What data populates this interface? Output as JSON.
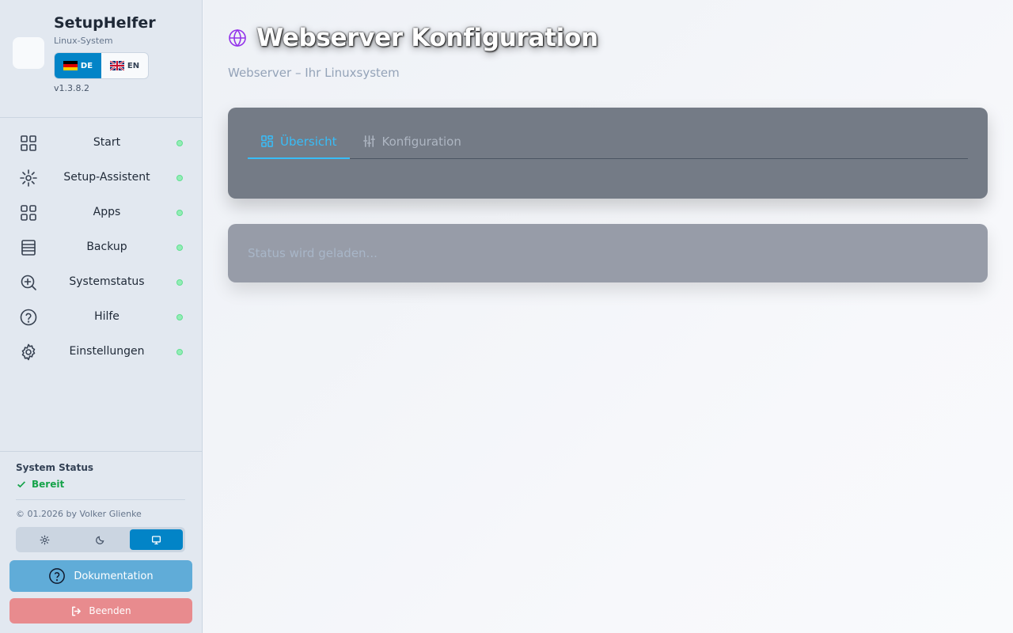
{
  "app": {
    "title": "SetupHelfer",
    "subtitle": "Linux-System",
    "version": "v1.3.8.2",
    "languages": [
      {
        "code": "DE",
        "active": true
      },
      {
        "code": "EN",
        "active": false
      }
    ]
  },
  "sidebar": {
    "items": [
      {
        "label": "Start",
        "icon": "grid-icon"
      },
      {
        "label": "Setup-Assistent",
        "icon": "wand-icon"
      },
      {
        "label": "Apps",
        "icon": "apps-icon"
      },
      {
        "label": "Backup",
        "icon": "database-icon"
      },
      {
        "label": "Systemstatus",
        "icon": "zoom-in-icon"
      },
      {
        "label": "Hilfe",
        "icon": "help-circle-icon"
      },
      {
        "label": "Einstellungen",
        "icon": "gear-icon"
      }
    ],
    "status_dot_color": "#86efac"
  },
  "system_status": {
    "title": "System Status",
    "state": "Bereit"
  },
  "footer": {
    "copyright": "© 01.2026 by Volker Glienke",
    "theme_options": [
      "light",
      "dark",
      "system"
    ],
    "theme_selected": "system",
    "docs_button": "Dokumentation",
    "exit_button": "Beenden"
  },
  "main": {
    "title": "Webserver Konfiguration",
    "subtitle": "Webserver – Ihr Linuxsystem",
    "tabs": [
      {
        "label": "Übersicht",
        "active": true
      },
      {
        "label": "Konfiguration",
        "active": false
      }
    ],
    "status_card_text": "Status wird geladen..."
  },
  "colors": {
    "accent": "#0284c7",
    "tab_active": "#38bdf8",
    "success": "#16a34a",
    "danger_button": "#e88b8e",
    "docs_button": "#60acd8",
    "page_icon": "#9333ea"
  }
}
